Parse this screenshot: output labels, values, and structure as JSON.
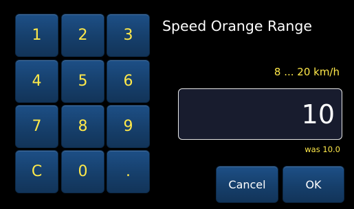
{
  "dialog": {
    "title": "Speed Orange Range",
    "range_label": "8 ... 20 km/h",
    "value": "10",
    "previous_value": "was 10.0"
  },
  "keypad": {
    "keys": [
      "1",
      "2",
      "3",
      "4",
      "5",
      "6",
      "7",
      "8",
      "9",
      "C",
      "0",
      "."
    ]
  },
  "buttons": {
    "cancel_label": "Cancel",
    "ok_label": "OK"
  },
  "colors": {
    "background": "#000000",
    "key_fill": "#1a4a7d",
    "key_text": "#ffe94a",
    "value_box": "#181c2e"
  }
}
